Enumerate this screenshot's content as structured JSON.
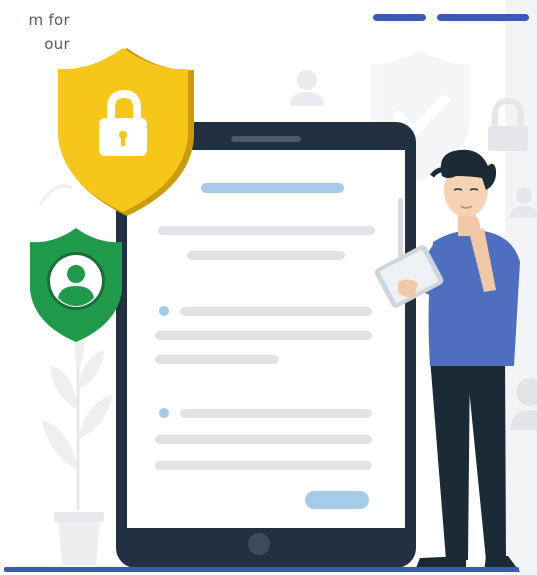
{
  "intro": {
    "line1": "m for",
    "line2": "our"
  },
  "colors": {
    "accent": "#3b5bb0",
    "tablet_frame": "#22313f",
    "shield_yellow": "#f6c619",
    "shield_green": "#1f9a4a",
    "bar_blue": "#a6cbe8",
    "bar_gray": "#e1e3e6",
    "shirt": "#4e6fbf",
    "pants": "#1b2b36"
  },
  "icons": {
    "lock_shield": "lock-shield-icon",
    "user_shield": "user-shield-icon",
    "check_shield": "check-shield-icon",
    "person": "person-icon",
    "lock": "lock-icon"
  }
}
